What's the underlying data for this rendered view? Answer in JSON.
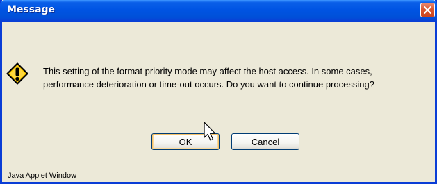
{
  "window": {
    "title": "Message",
    "message_line_1": "This setting of the format priority mode may affect the host access. In some cases,",
    "message_line_2": "performance deterioration or time-out occurs. Do you want to continue processing?",
    "status_text": "Java Applet Window"
  },
  "buttons": {
    "ok_label": "OK",
    "cancel_label": "Cancel"
  },
  "icons": {
    "dialog": "warning-icon",
    "close": "close-icon",
    "pointer": "mouse-pointer-icon"
  },
  "colors": {
    "titlebar": "#0054e3",
    "close_button": "#d9552e",
    "dialog_background": "#ece9d8",
    "warning_fill": "#ffcc00"
  }
}
